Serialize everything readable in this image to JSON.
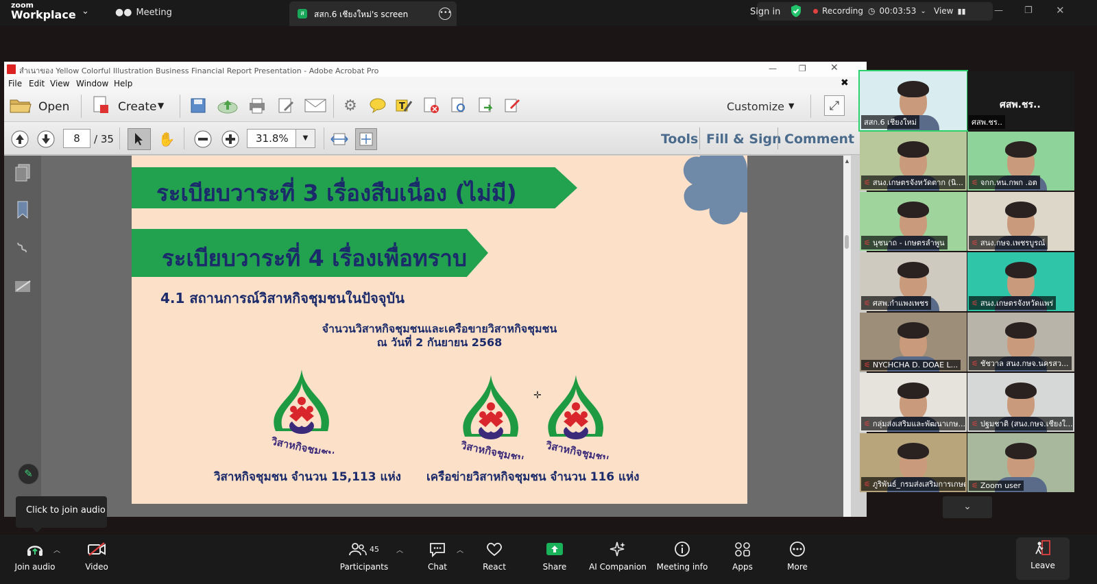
{
  "zoom": {
    "logo_top": "zoom",
    "logo_bottom": "Workplace",
    "meeting_label": "Meeting",
    "share_tab_title": "สสก.6 เชียงใหม่'s screen",
    "sign_in": "Sign in",
    "recording": "Recording",
    "timer": "00:03:53",
    "view": "View"
  },
  "acrobat": {
    "window_title": "สำเนาของ Yellow Colorful Illustration Business Financial Report Presentation - Adobe Acrobat Pro",
    "menu": [
      "File",
      "Edit",
      "View",
      "Window",
      "Help"
    ],
    "open_label": "Open",
    "create_label": "Create",
    "customize_label": "Customize",
    "page_current": "8",
    "page_total": "/ 35",
    "zoom": "31.8%",
    "tools_label": "Tools",
    "fill_sign_label": "Fill & Sign",
    "comment_label": "Comment"
  },
  "slide": {
    "agenda3": "ระเบียบวาระที่ 3 เรื่องสืบเนื่อง (ไม่มี)",
    "agenda4": "ระเบียบวาระที่ 4 เรื่องเพื่อทราบ",
    "subheading": "4.1 สถานการณ์วิสาหกิจชุมชนในปัจจุบัน",
    "caption_line1": "จำนวนวิสาหกิจชุมชนและเครือขายวิสาหกิจชุมชน",
    "caption_line2": "ณ วันที่ 2 กันยายน 2568",
    "logo_text": "วิสาหกิจชุมชน",
    "stat_enterprises": "วิสาหกิจชุมชน จำนวน 15,113 แห่ง",
    "stat_networks": "เครือข่ายวิสาหกิจชุมชน จำนวน 116 แห่ง",
    "colors": {
      "background": "#fce1c8",
      "band": "#22a24f",
      "text": "#1b2a6a"
    }
  },
  "gallery": {
    "big_name": "ศสพ.ชร..",
    "tiles": [
      {
        "name": "สสก.6 เชียงใหม่",
        "bg": "#d9ecef",
        "muted": false
      },
      {
        "name": "ศสพ.ชร..",
        "bg": "#1a1a1a",
        "muted": false
      },
      {
        "name": "สนง.เกษตรจังหวัดตาก (นิ...",
        "bg": "#b9c89a",
        "muted": true
      },
      {
        "name": "จกก.หน.กพก .อต",
        "bg": "#8ed49a",
        "muted": true
      },
      {
        "name": "นุชนาถ - เกษตรลำพูน",
        "bg": "#9fd59d",
        "muted": true
      },
      {
        "name": "สนง.กษจ.เพชรบูรณ์",
        "bg": "#dcd7c9",
        "muted": true
      },
      {
        "name": "ศสพ.กำแพงเพชร",
        "bg": "#cfcac0",
        "muted": true
      },
      {
        "name": "สนง.เกษตรจังหวัดแพร่",
        "bg": "#2ec5a8",
        "muted": true
      },
      {
        "name": "NYCHCHA D. DOAE L...",
        "bg": "#9c8e78",
        "muted": true
      },
      {
        "name": "ชัชวาล สนง.กษจ.นครสว...",
        "bg": "#b8b4aa",
        "muted": true
      },
      {
        "name": "กลุ่มส่งเสริมและพัฒนาเกษ...",
        "bg": "#e6e3dc",
        "muted": true
      },
      {
        "name": "ปฐมชาติ (สนง.กษจ.เชียงใ...",
        "bg": "#d5d8d6",
        "muted": true
      },
      {
        "name": "ภูริพันธ์_กรมส่งเสริมการเกษตร",
        "bg": "#b8a57c",
        "muted": true
      },
      {
        "name": "Zoom user",
        "bg": "#a8b89c",
        "muted": true
      }
    ]
  },
  "bottombar": {
    "join_audio": "Join audio",
    "video": "Video",
    "participants": "Participants",
    "participants_count": "45",
    "chat": "Chat",
    "react": "React",
    "share": "Share",
    "ai_companion": "AI Companion",
    "meeting_info": "Meeting info",
    "apps": "Apps",
    "more": "More",
    "leave": "Leave",
    "tooltip": "Click to join audio"
  }
}
